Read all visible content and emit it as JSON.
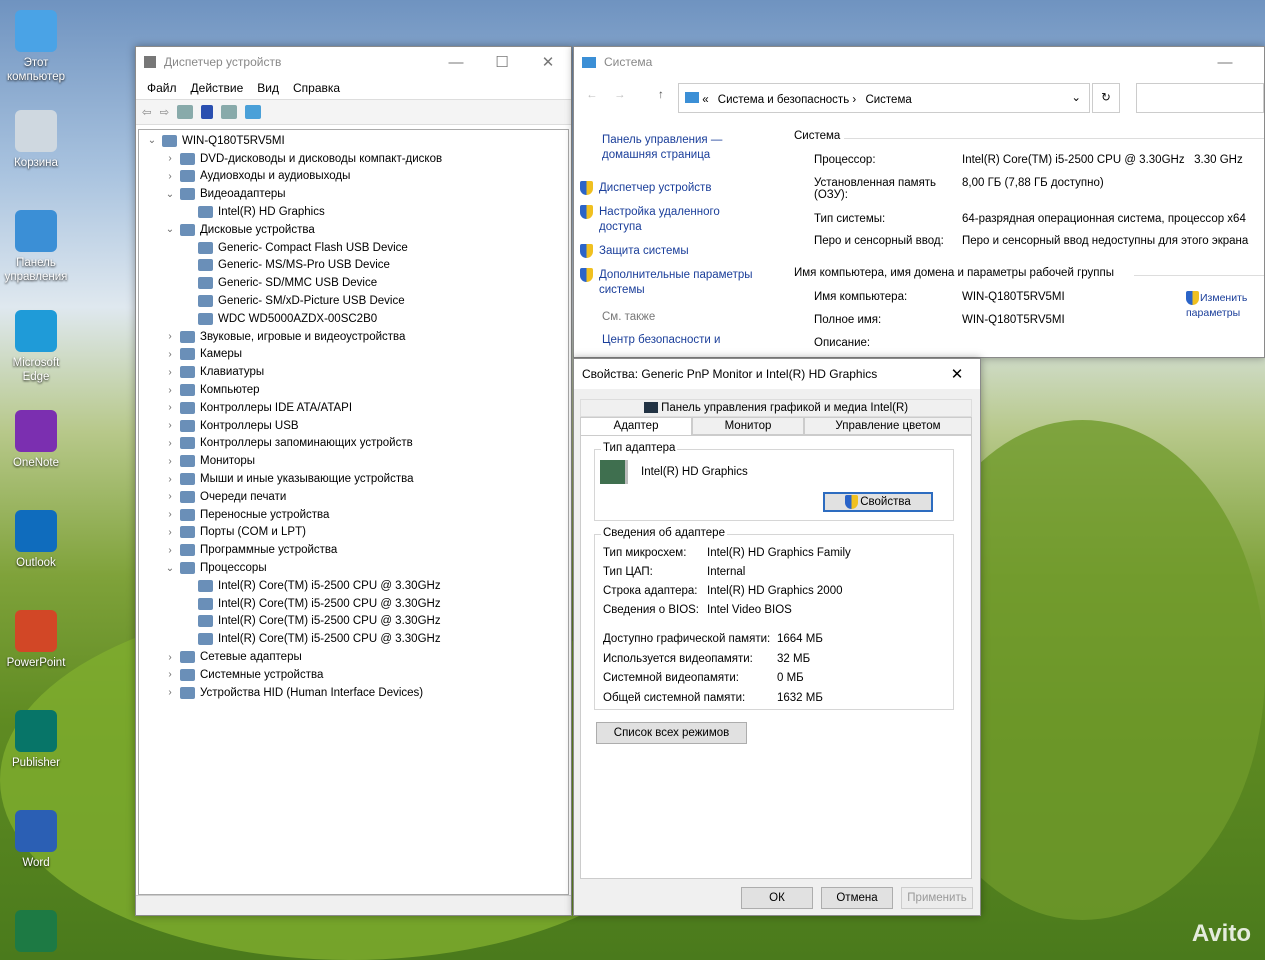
{
  "desktop": {
    "icons": [
      {
        "label": "Этот компьютер",
        "color": "#4aa3e6"
      },
      {
        "label": "Корзина",
        "color": "#cfd8e0"
      },
      {
        "label": "Панель управления",
        "color": "#3b8fd6"
      },
      {
        "label": "Microsoft Edge",
        "color": "#1f9bd8"
      },
      {
        "label": "OneNote",
        "color": "#7b2fb0"
      },
      {
        "label": "Outlook",
        "color": "#0f6cbd"
      },
      {
        "label": "PowerPoint",
        "color": "#d24726"
      },
      {
        "label": "Publisher",
        "color": "#077568"
      },
      {
        "label": "Word",
        "color": "#2b5fb4"
      },
      {
        "label": "",
        "color": "#1d7a44"
      }
    ],
    "watermark": "Avito"
  },
  "devmgr": {
    "title": "Диспетчер устройств",
    "menu": [
      "Файл",
      "Действие",
      "Вид",
      "Справка"
    ],
    "tree": [
      {
        "l": 0,
        "e": "v",
        "t": "WIN-Q180T5RV5MI"
      },
      {
        "l": 1,
        "e": ">",
        "t": "DVD-дисководы и дисководы компакт-дисков"
      },
      {
        "l": 1,
        "e": ">",
        "t": "Аудиовходы и аудиовыходы"
      },
      {
        "l": 1,
        "e": "v",
        "t": "Видеоадаптеры"
      },
      {
        "l": 2,
        "e": "",
        "t": "Intel(R) HD Graphics"
      },
      {
        "l": 1,
        "e": "v",
        "t": "Дисковые устройства"
      },
      {
        "l": 2,
        "e": "",
        "t": "Generic- Compact Flash USB Device"
      },
      {
        "l": 2,
        "e": "",
        "t": "Generic- MS/MS-Pro USB Device"
      },
      {
        "l": 2,
        "e": "",
        "t": "Generic- SD/MMC USB Device"
      },
      {
        "l": 2,
        "e": "",
        "t": "Generic- SM/xD-Picture USB Device"
      },
      {
        "l": 2,
        "e": "",
        "t": "WDC WD5000AZDX-00SC2B0"
      },
      {
        "l": 1,
        "e": ">",
        "t": "Звуковые, игровые и видеоустройства"
      },
      {
        "l": 1,
        "e": ">",
        "t": "Камеры"
      },
      {
        "l": 1,
        "e": ">",
        "t": "Клавиатуры"
      },
      {
        "l": 1,
        "e": ">",
        "t": "Компьютер"
      },
      {
        "l": 1,
        "e": ">",
        "t": "Контроллеры IDE ATA/ATAPI"
      },
      {
        "l": 1,
        "e": ">",
        "t": "Контроллеры USB"
      },
      {
        "l": 1,
        "e": ">",
        "t": "Контроллеры запоминающих устройств"
      },
      {
        "l": 1,
        "e": ">",
        "t": "Мониторы"
      },
      {
        "l": 1,
        "e": ">",
        "t": "Мыши и иные указывающие устройства"
      },
      {
        "l": 1,
        "e": ">",
        "t": "Очереди печати"
      },
      {
        "l": 1,
        "e": ">",
        "t": "Переносные устройства"
      },
      {
        "l": 1,
        "e": ">",
        "t": "Порты (COM и LPT)"
      },
      {
        "l": 1,
        "e": ">",
        "t": "Программные устройства"
      },
      {
        "l": 1,
        "e": "v",
        "t": "Процессоры"
      },
      {
        "l": 2,
        "e": "",
        "t": "Intel(R) Core(TM) i5-2500 CPU @ 3.30GHz"
      },
      {
        "l": 2,
        "e": "",
        "t": "Intel(R) Core(TM) i5-2500 CPU @ 3.30GHz"
      },
      {
        "l": 2,
        "e": "",
        "t": "Intel(R) Core(TM) i5-2500 CPU @ 3.30GHz"
      },
      {
        "l": 2,
        "e": "",
        "t": "Intel(R) Core(TM) i5-2500 CPU @ 3.30GHz"
      },
      {
        "l": 1,
        "e": ">",
        "t": "Сетевые адаптеры"
      },
      {
        "l": 1,
        "e": ">",
        "t": "Системные устройства"
      },
      {
        "l": 1,
        "e": ">",
        "t": "Устройства HID (Human Interface Devices)"
      }
    ]
  },
  "system": {
    "title": "Система",
    "breadcrumb": [
      "Система и безопасность",
      "Система"
    ],
    "left": {
      "home": "Панель управления — домашняя страница",
      "links": [
        "Диспетчер устройств",
        "Настройка удаленного доступа",
        "Защита системы",
        "Дополнительные параметры системы"
      ],
      "see_also": "См. также",
      "cut": "Центр безопасности и"
    },
    "section1": "Система",
    "processor_label": "Процессор:",
    "processor": "Intel(R) Core(TM) i5-2500 CPU @ 3.30GHz   3.30 GHz",
    "ram_label": "Установленная память (ОЗУ):",
    "ram": "8,00 ГБ (7,88 ГБ доступно)",
    "type_label": "Тип системы:",
    "type": "64-разрядная операционная система, процессор x64",
    "pen_label": "Перо и сенсорный ввод:",
    "pen": "Перо и сенсорный ввод недоступны для этого экрана",
    "section2": "Имя компьютера, имя домена и параметры рабочей группы",
    "name_label": "Имя компьютера:",
    "name": "WIN-Q180T5RV5MI",
    "full_label": "Полное имя:",
    "full": "WIN-Q180T5RV5MI",
    "desc_label": "Описание:",
    "change": "Изменить параметры"
  },
  "props": {
    "title": "Свойства: Generic PnP Monitor и Intel(R) HD Graphics",
    "intel_tab": "Панель управления графикой и медиа Intel(R)",
    "tabs": [
      "Адаптер",
      "Монитор",
      "Управление цветом"
    ],
    "adapter_group": "Тип адаптера",
    "adapter": "Intel(R) HD Graphics",
    "props_btn": "Свойства",
    "info_group": "Сведения об адаптере",
    "info": [
      [
        "Тип микросхем:",
        "Intel(R) HD Graphics Family"
      ],
      [
        "Тип ЦАП:",
        "Internal"
      ],
      [
        "Строка адаптера:",
        "Intel(R) HD Graphics 2000"
      ],
      [
        "Сведения о BIOS:",
        "Intel Video BIOS"
      ]
    ],
    "mem": [
      [
        "Доступно графической памяти:",
        "1664 МБ"
      ],
      [
        "Используется видеопамяти:",
        "32 МБ"
      ],
      [
        "Системной видеопамяти:",
        "0 МБ"
      ],
      [
        "Общей системной памяти:",
        "1632 МБ"
      ]
    ],
    "modes_btn": "Список всех режимов",
    "ok": "ОК",
    "cancel": "Отмена",
    "apply": "Применить"
  }
}
